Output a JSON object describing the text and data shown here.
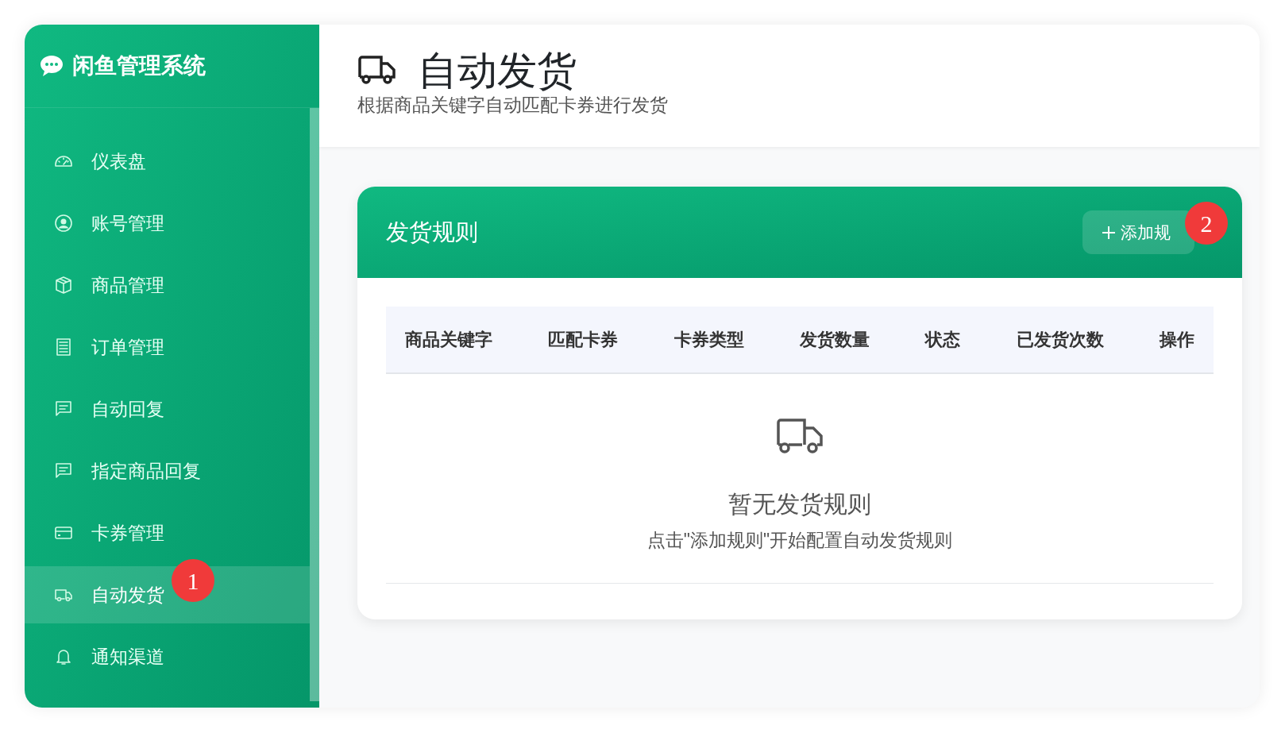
{
  "sidebar": {
    "title": "闲鱼管理系统",
    "items": [
      {
        "label": "仪表盘",
        "selected": false
      },
      {
        "label": "账号管理",
        "selected": false
      },
      {
        "label": "商品管理",
        "selected": false
      },
      {
        "label": "订单管理",
        "selected": false
      },
      {
        "label": "自动回复",
        "selected": false
      },
      {
        "label": "指定商品回复",
        "selected": false
      },
      {
        "label": "卡券管理",
        "selected": false
      },
      {
        "label": "自动发货",
        "selected": true
      },
      {
        "label": "通知渠道",
        "selected": false
      }
    ]
  },
  "header": {
    "title": "自动发货",
    "subtitle": "根据商品关键字自动匹配卡券进行发货"
  },
  "card": {
    "title": "发货规则",
    "add_button": "添加规"
  },
  "table": {
    "columns": [
      "商品关键字",
      "匹配卡券",
      "卡券类型",
      "发货数量",
      "状态",
      "已发货次数",
      "操作"
    ]
  },
  "empty_state": {
    "title": "暂无发货规则",
    "hint": "点击\"添加规则\"开始配置自动发货规则"
  },
  "markers": [
    {
      "label": "1"
    },
    {
      "label": "2"
    }
  ]
}
